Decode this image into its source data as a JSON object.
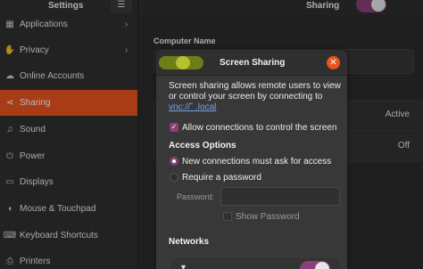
{
  "header": {
    "app_title": "Settings",
    "page_title": "Sharing",
    "menu_icon": "hamburger-icon",
    "sharing_toggle_on": true,
    "accent": "#8a3f78"
  },
  "sidebar": {
    "items": [
      {
        "label": "Applications",
        "icon": "apps-icon",
        "chevron": true,
        "active": false
      },
      {
        "label": "Privacy",
        "icon": "hand-icon",
        "chevron": true,
        "active": false
      },
      {
        "label": "Online Accounts",
        "icon": "cloud-icon",
        "chevron": false,
        "active": false
      },
      {
        "label": "Sharing",
        "icon": "share-icon",
        "chevron": false,
        "active": true
      },
      {
        "label": "Sound",
        "icon": "music-note-icon",
        "chevron": false,
        "active": false
      },
      {
        "label": "Power",
        "icon": "power-icon",
        "chevron": false,
        "active": false
      },
      {
        "label": "Displays",
        "icon": "display-icon",
        "chevron": false,
        "active": false
      },
      {
        "label": "Mouse & Touchpad",
        "icon": "mouse-icon",
        "chevron": false,
        "active": false
      },
      {
        "label": "Keyboard Shortcuts",
        "icon": "keyboard-icon",
        "chevron": false,
        "active": false
      },
      {
        "label": "Printers",
        "icon": "printer-icon",
        "chevron": false,
        "active": false
      }
    ],
    "active_color": "#e95420"
  },
  "main": {
    "computer_name_label": "Computer Name",
    "rows": [
      {
        "status": "Active"
      },
      {
        "status": "Off"
      }
    ]
  },
  "dialog": {
    "title": "Screen Sharing",
    "enabled": true,
    "description": "Screen sharing allows remote users to view or control your screen by connecting to",
    "vnc_address": "vnc://˘ .local",
    "allow_control_label": "Allow connections to control the screen",
    "allow_control_checked": true,
    "access_options_heading": "Access Options",
    "access_options": [
      {
        "label": "New connections must ask for access",
        "selected": true
      },
      {
        "label": "Require a password",
        "selected": false
      }
    ],
    "password_label": "Password:",
    "password_value": "",
    "show_password_label": "Show Password",
    "show_password_checked": false,
    "networks_heading": "Networks",
    "network_toggle_on": true,
    "close_color": "#e95420"
  }
}
